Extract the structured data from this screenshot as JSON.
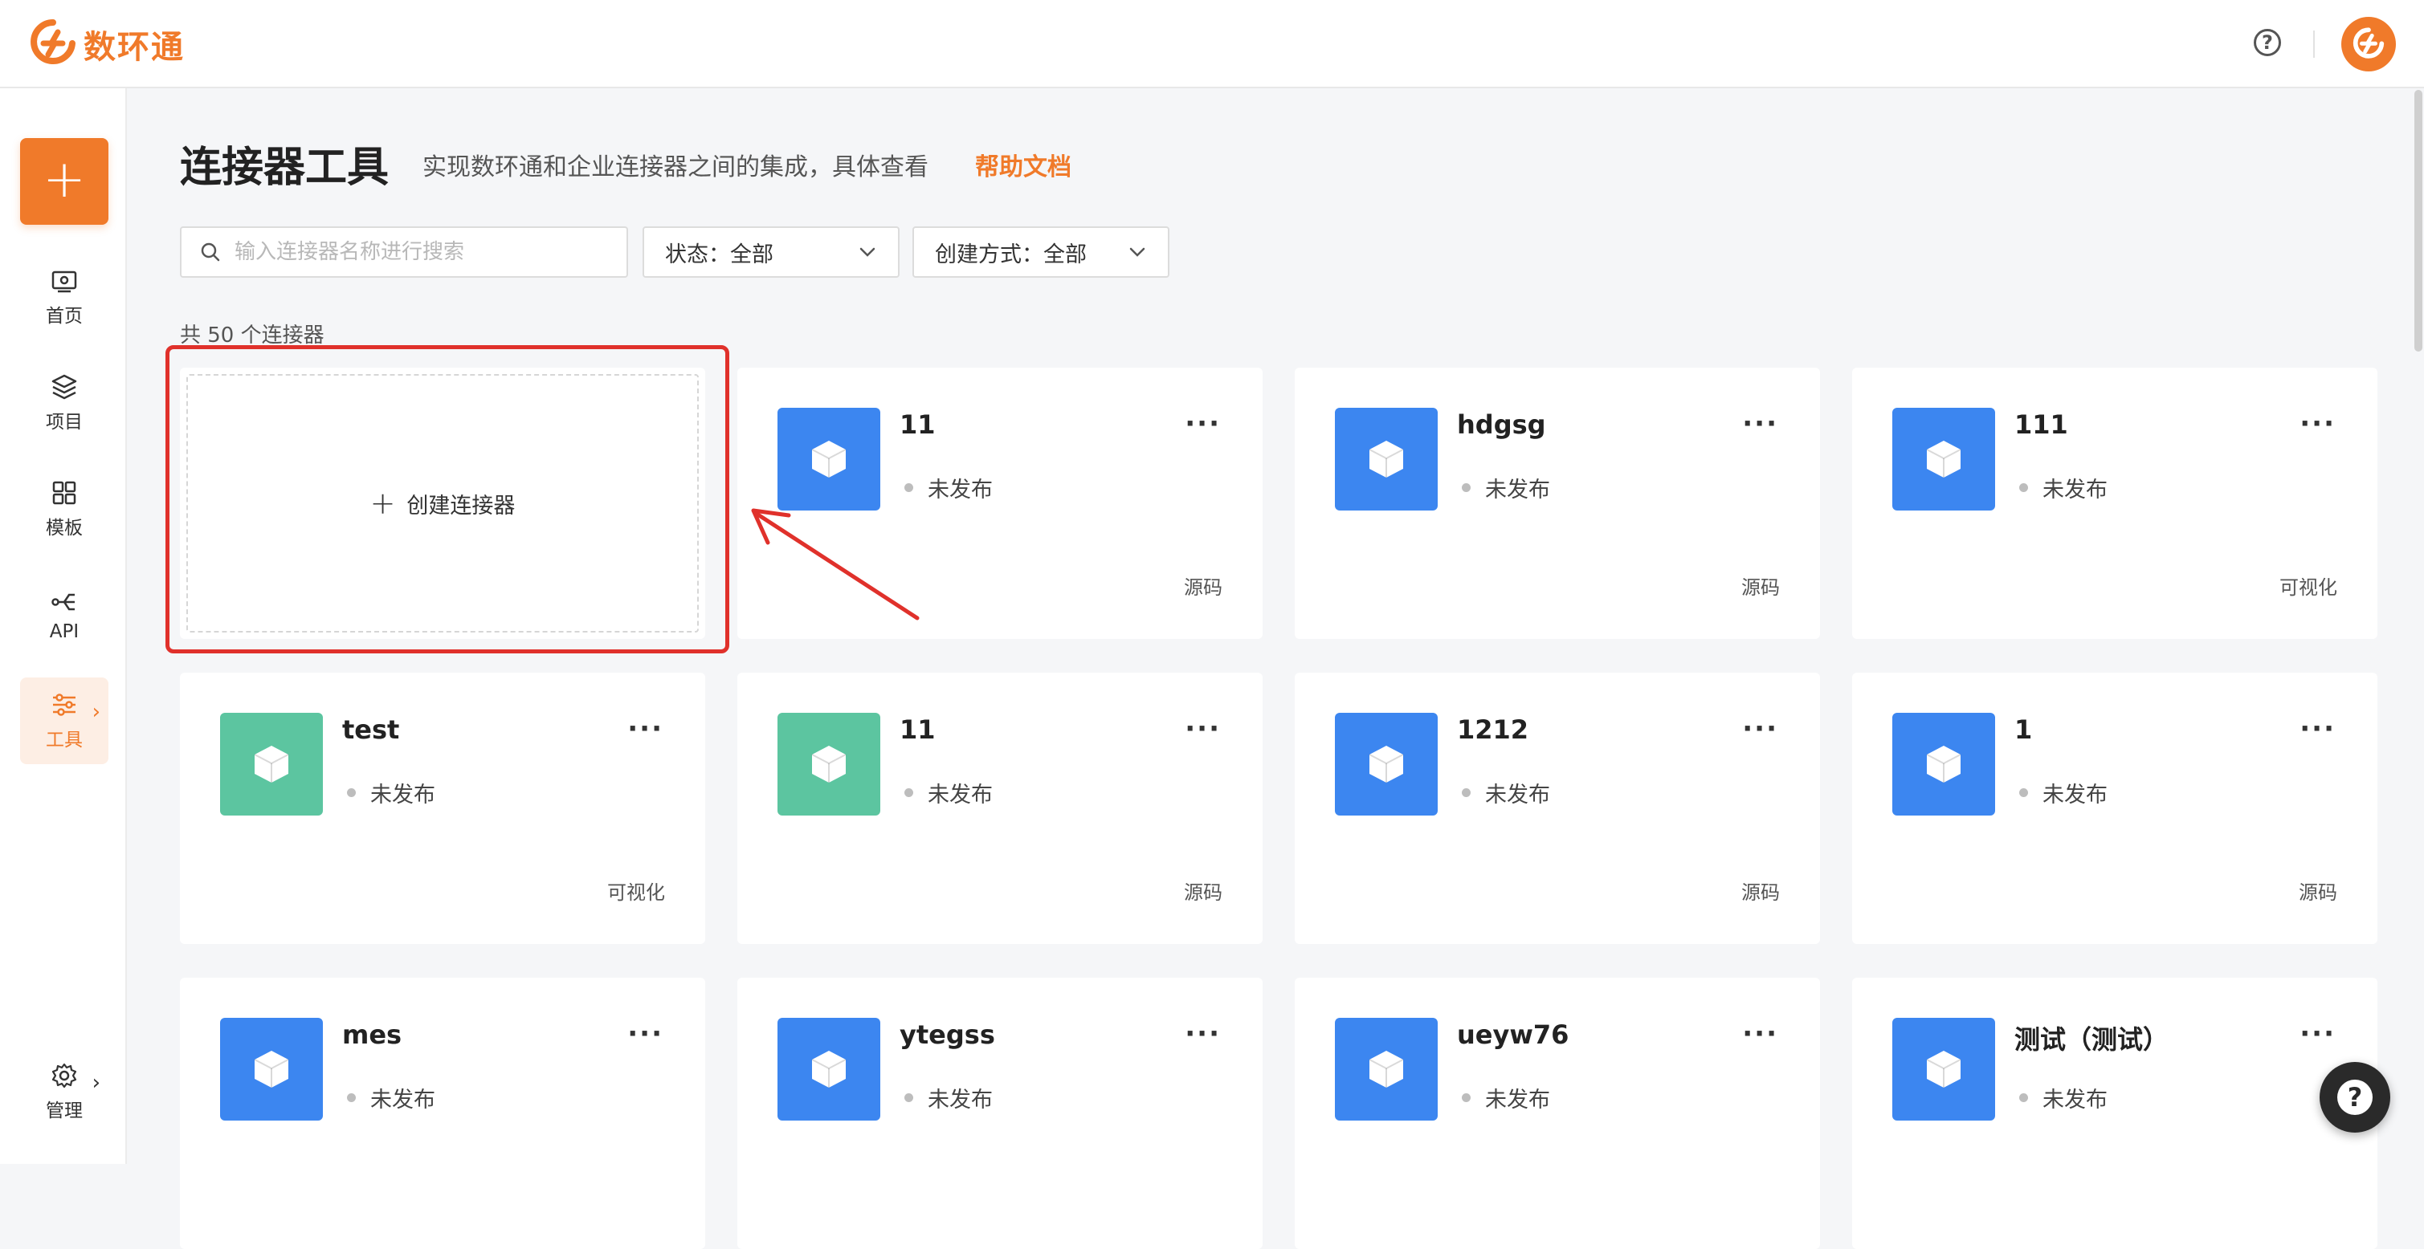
{
  "app": {
    "name": "数环通"
  },
  "colors": {
    "accent": "#f07a2a",
    "blue_icon": "#3c86f0",
    "green_icon": "#5cc5a0",
    "highlight": "#e0312b"
  },
  "header": {
    "help_icon": "question-circle-icon",
    "help_glyph": "?"
  },
  "sidebar": {
    "add_glyph": "+",
    "items": [
      {
        "label": "首页",
        "icon": "home-icon"
      },
      {
        "label": "项目",
        "icon": "layers-icon"
      },
      {
        "label": "模板",
        "icon": "grid-icon"
      },
      {
        "label": "API",
        "icon": "api-icon"
      },
      {
        "label": "工具",
        "icon": "sliders-icon",
        "active": true
      }
    ],
    "manage": {
      "label": "管理",
      "icon": "gear-icon"
    },
    "arrow_glyph": "›"
  },
  "main": {
    "title": "连接器工具",
    "description": "实现数环通和企业连接器之间的集成，具体查看",
    "help_link": "帮助文档",
    "search": {
      "placeholder": "输入连接器名称进行搜索",
      "value": ""
    },
    "filters": {
      "status": "状态：全部",
      "create_method": "创建方式：全部"
    },
    "count_text": "共 50 个连接器",
    "create_card": {
      "plus": "+",
      "label": "创建连接器"
    },
    "more_glyph": "···",
    "cards": [
      {
        "name": "11",
        "status": "未发布",
        "type": "源码",
        "icon_color": "blue"
      },
      {
        "name": "hdgsg",
        "status": "未发布",
        "type": "源码",
        "icon_color": "blue"
      },
      {
        "name": "111",
        "status": "未发布",
        "type": "可视化",
        "icon_color": "blue"
      },
      {
        "name": "test",
        "status": "未发布",
        "type": "可视化",
        "icon_color": "green"
      },
      {
        "name": "11",
        "status": "未发布",
        "type": "源码",
        "icon_color": "green"
      },
      {
        "name": "1212",
        "status": "未发布",
        "type": "源码",
        "icon_color": "blue"
      },
      {
        "name": "1",
        "status": "未发布",
        "type": "源码",
        "icon_color": "blue"
      },
      {
        "name": "mes",
        "status": "未发布",
        "type": "",
        "icon_color": "blue"
      },
      {
        "name": "ytegss",
        "status": "未发布",
        "type": "",
        "icon_color": "blue"
      },
      {
        "name": "ueyw76",
        "status": "未发布",
        "type": "",
        "icon_color": "blue"
      },
      {
        "name": "测试（测试）",
        "status": "未发布",
        "type": "",
        "icon_color": "blue"
      }
    ]
  },
  "float_help": {
    "glyph": "?"
  }
}
